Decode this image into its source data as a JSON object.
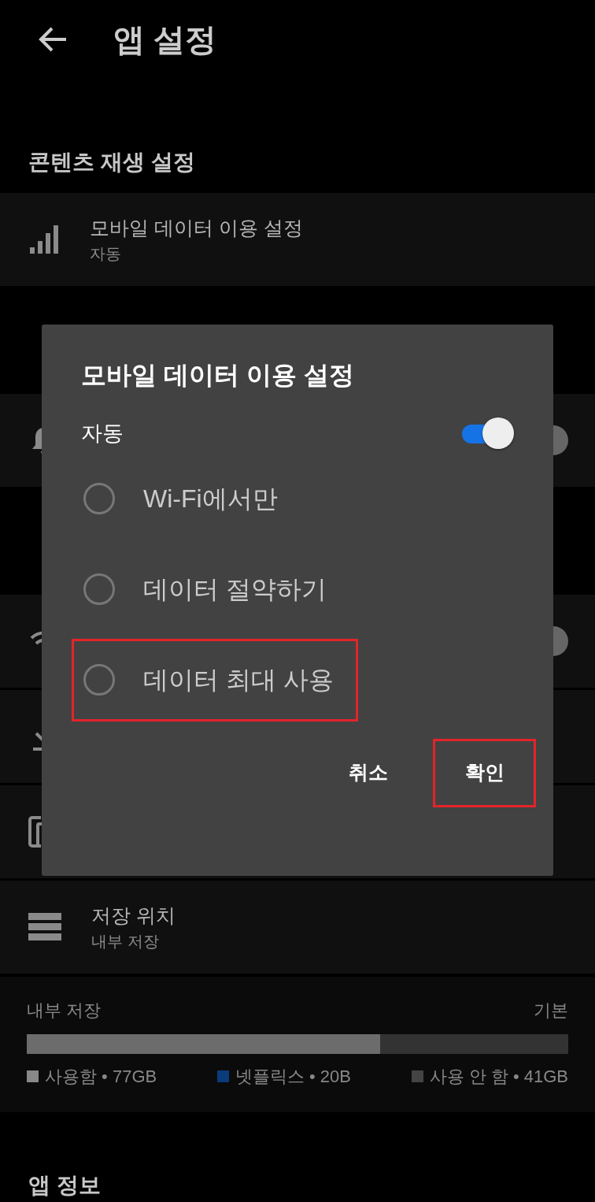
{
  "header": {
    "title": "앱 설정"
  },
  "sections": [
    {
      "title": "콘텐츠 재생 설정",
      "rows": [
        {
          "kind": "link",
          "title": "모바일 데이터 이용 설정",
          "subtitle": "자동"
        }
      ]
    },
    {
      "rows": [
        {
          "kind": "toggle",
          "on": true
        }
      ]
    },
    {
      "rows": [
        {
          "kind": "toggle",
          "on": true
        },
        {
          "kind": "link"
        },
        {
          "kind": "link"
        },
        {
          "kind": "link",
          "title": "저장 위치",
          "subtitle": "내부 저장"
        }
      ]
    }
  ],
  "storage": {
    "label": "내부 저장",
    "value": "기본",
    "level": 0.653,
    "legend": [
      {
        "text": "사용함 • 77GB",
        "color": "#888888"
      },
      {
        "text": "넷플릭스 • 20B",
        "color": "#0a3b7a"
      },
      {
        "text": "사용 안 함 • 41GB",
        "color": "#444444"
      }
    ]
  },
  "footer_section": {
    "title": "앱 정보"
  },
  "dialog": {
    "title": "모바일 데이터 이용 설정",
    "toggle": {
      "label": "자동",
      "on": true
    },
    "options": [
      {
        "label": "Wi-Fi에서만",
        "selected": false,
        "highlighted": false
      },
      {
        "label": "데이터 절약하기",
        "selected": false,
        "highlighted": false
      },
      {
        "label": "데이터 최대 사용",
        "selected": false,
        "highlighted": true
      }
    ],
    "buttons": [
      {
        "label": "취소",
        "highlighted": false
      },
      {
        "label": "확인",
        "highlighted": true
      }
    ]
  }
}
